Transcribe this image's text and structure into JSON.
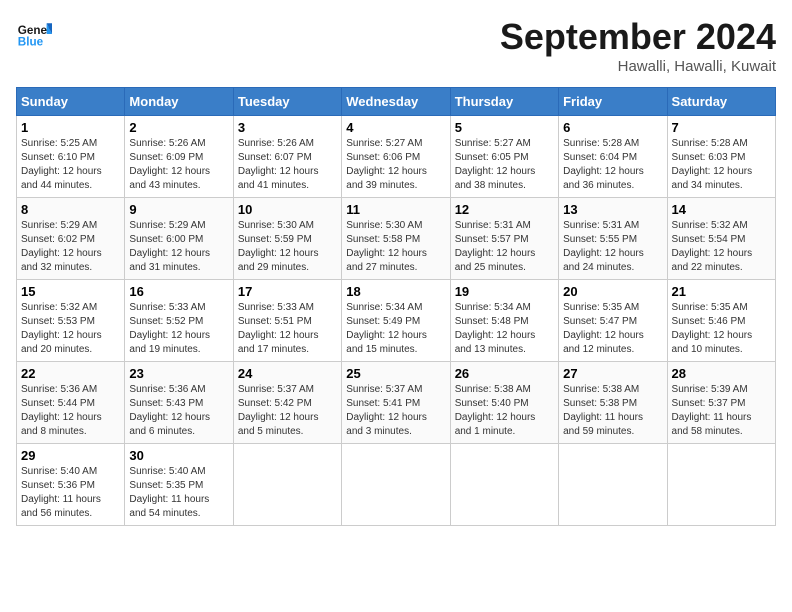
{
  "header": {
    "logo": "GeneralBlue",
    "month": "September 2024",
    "location": "Hawalli, Hawalli, Kuwait"
  },
  "weekdays": [
    "Sunday",
    "Monday",
    "Tuesday",
    "Wednesday",
    "Thursday",
    "Friday",
    "Saturday"
  ],
  "weeks": [
    [
      {
        "day": "1",
        "info": "Sunrise: 5:25 AM\nSunset: 6:10 PM\nDaylight: 12 hours\nand 44 minutes."
      },
      {
        "day": "2",
        "info": "Sunrise: 5:26 AM\nSunset: 6:09 PM\nDaylight: 12 hours\nand 43 minutes."
      },
      {
        "day": "3",
        "info": "Sunrise: 5:26 AM\nSunset: 6:07 PM\nDaylight: 12 hours\nand 41 minutes."
      },
      {
        "day": "4",
        "info": "Sunrise: 5:27 AM\nSunset: 6:06 PM\nDaylight: 12 hours\nand 39 minutes."
      },
      {
        "day": "5",
        "info": "Sunrise: 5:27 AM\nSunset: 6:05 PM\nDaylight: 12 hours\nand 38 minutes."
      },
      {
        "day": "6",
        "info": "Sunrise: 5:28 AM\nSunset: 6:04 PM\nDaylight: 12 hours\nand 36 minutes."
      },
      {
        "day": "7",
        "info": "Sunrise: 5:28 AM\nSunset: 6:03 PM\nDaylight: 12 hours\nand 34 minutes."
      }
    ],
    [
      {
        "day": "8",
        "info": "Sunrise: 5:29 AM\nSunset: 6:02 PM\nDaylight: 12 hours\nand 32 minutes."
      },
      {
        "day": "9",
        "info": "Sunrise: 5:29 AM\nSunset: 6:00 PM\nDaylight: 12 hours\nand 31 minutes."
      },
      {
        "day": "10",
        "info": "Sunrise: 5:30 AM\nSunset: 5:59 PM\nDaylight: 12 hours\nand 29 minutes."
      },
      {
        "day": "11",
        "info": "Sunrise: 5:30 AM\nSunset: 5:58 PM\nDaylight: 12 hours\nand 27 minutes."
      },
      {
        "day": "12",
        "info": "Sunrise: 5:31 AM\nSunset: 5:57 PM\nDaylight: 12 hours\nand 25 minutes."
      },
      {
        "day": "13",
        "info": "Sunrise: 5:31 AM\nSunset: 5:55 PM\nDaylight: 12 hours\nand 24 minutes."
      },
      {
        "day": "14",
        "info": "Sunrise: 5:32 AM\nSunset: 5:54 PM\nDaylight: 12 hours\nand 22 minutes."
      }
    ],
    [
      {
        "day": "15",
        "info": "Sunrise: 5:32 AM\nSunset: 5:53 PM\nDaylight: 12 hours\nand 20 minutes."
      },
      {
        "day": "16",
        "info": "Sunrise: 5:33 AM\nSunset: 5:52 PM\nDaylight: 12 hours\nand 19 minutes."
      },
      {
        "day": "17",
        "info": "Sunrise: 5:33 AM\nSunset: 5:51 PM\nDaylight: 12 hours\nand 17 minutes."
      },
      {
        "day": "18",
        "info": "Sunrise: 5:34 AM\nSunset: 5:49 PM\nDaylight: 12 hours\nand 15 minutes."
      },
      {
        "day": "19",
        "info": "Sunrise: 5:34 AM\nSunset: 5:48 PM\nDaylight: 12 hours\nand 13 minutes."
      },
      {
        "day": "20",
        "info": "Sunrise: 5:35 AM\nSunset: 5:47 PM\nDaylight: 12 hours\nand 12 minutes."
      },
      {
        "day": "21",
        "info": "Sunrise: 5:35 AM\nSunset: 5:46 PM\nDaylight: 12 hours\nand 10 minutes."
      }
    ],
    [
      {
        "day": "22",
        "info": "Sunrise: 5:36 AM\nSunset: 5:44 PM\nDaylight: 12 hours\nand 8 minutes."
      },
      {
        "day": "23",
        "info": "Sunrise: 5:36 AM\nSunset: 5:43 PM\nDaylight: 12 hours\nand 6 minutes."
      },
      {
        "day": "24",
        "info": "Sunrise: 5:37 AM\nSunset: 5:42 PM\nDaylight: 12 hours\nand 5 minutes."
      },
      {
        "day": "25",
        "info": "Sunrise: 5:37 AM\nSunset: 5:41 PM\nDaylight: 12 hours\nand 3 minutes."
      },
      {
        "day": "26",
        "info": "Sunrise: 5:38 AM\nSunset: 5:40 PM\nDaylight: 12 hours\nand 1 minute."
      },
      {
        "day": "27",
        "info": "Sunrise: 5:38 AM\nSunset: 5:38 PM\nDaylight: 11 hours\nand 59 minutes."
      },
      {
        "day": "28",
        "info": "Sunrise: 5:39 AM\nSunset: 5:37 PM\nDaylight: 11 hours\nand 58 minutes."
      }
    ],
    [
      {
        "day": "29",
        "info": "Sunrise: 5:40 AM\nSunset: 5:36 PM\nDaylight: 11 hours\nand 56 minutes."
      },
      {
        "day": "30",
        "info": "Sunrise: 5:40 AM\nSunset: 5:35 PM\nDaylight: 11 hours\nand 54 minutes."
      },
      {
        "day": "",
        "info": ""
      },
      {
        "day": "",
        "info": ""
      },
      {
        "day": "",
        "info": ""
      },
      {
        "day": "",
        "info": ""
      },
      {
        "day": "",
        "info": ""
      }
    ]
  ]
}
